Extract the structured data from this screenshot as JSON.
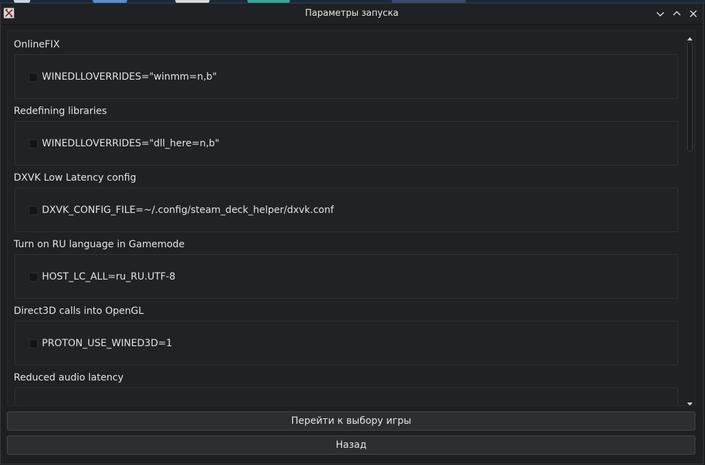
{
  "window": {
    "title": "Параметры запуска"
  },
  "options": [
    {
      "title": "OnlineFIX",
      "value": "WINEDLLOVERRIDES=\"winmm=n,b\"",
      "checked": false
    },
    {
      "title": "Redefining libraries",
      "value": "WINEDLLOVERRIDES=\"dll_here=n,b\"",
      "checked": false
    },
    {
      "title": "DXVK Low Latency config",
      "value": "DXVK_CONFIG_FILE=~/.config/steam_deck_helper/dxvk.conf",
      "checked": false
    },
    {
      "title": "Turn on RU language in Gamemode",
      "value": "HOST_LC_ALL=ru_RU.UTF-8",
      "checked": false
    },
    {
      "title": "Direct3D calls into OpenGL",
      "value": "PROTON_USE_WINED3D=1",
      "checked": false
    },
    {
      "title": "Reduced audio latency",
      "value": "",
      "checked": false
    }
  ],
  "buttons": {
    "select_game": "Перейти к выбору игры",
    "back": "Назад"
  },
  "icons": {
    "app": "app-logo-icon",
    "minimize": "chevron-down-icon",
    "maximize": "chevron-up-icon",
    "close": "close-icon",
    "scroll_up": "triangle-up-icon",
    "scroll_down": "triangle-down-icon"
  },
  "colors": {
    "background": "#1e1f21",
    "panel": "#202124",
    "text": "#e3e5e7",
    "button": "#2d2e31",
    "border": "#303236"
  }
}
